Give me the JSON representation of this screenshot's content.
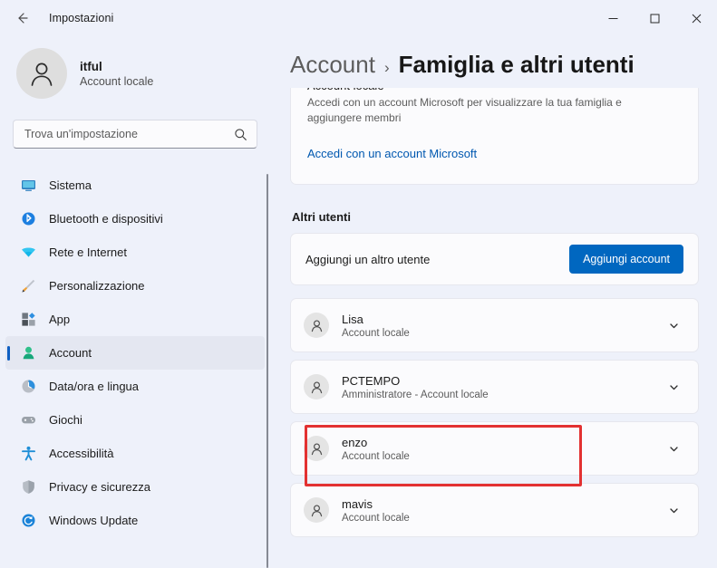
{
  "window": {
    "title": "Impostazioni",
    "back_icon": "back-arrow-icon",
    "minimize_label": "—",
    "maximize_label": "☐",
    "close_label": "✕"
  },
  "sidebar": {
    "profile": {
      "name": "itful",
      "subtitle": "Account locale",
      "avatar_icon": "person-icon"
    },
    "search": {
      "placeholder": "Trova un'impostazione",
      "value": "",
      "icon": "search-icon"
    },
    "items": [
      {
        "label": "Sistema",
        "icon": "monitor-icon",
        "selected": false
      },
      {
        "label": "Bluetooth e dispositivi",
        "icon": "bluetooth-icon",
        "selected": false
      },
      {
        "label": "Rete e Internet",
        "icon": "wifi-icon",
        "selected": false
      },
      {
        "label": "Personalizzazione",
        "icon": "paintbrush-icon",
        "selected": false
      },
      {
        "label": "App",
        "icon": "apps-icon",
        "selected": false
      },
      {
        "label": "Account",
        "icon": "account-person-icon",
        "selected": true
      },
      {
        "label": "Data/ora e lingua",
        "icon": "clock-icon",
        "selected": false
      },
      {
        "label": "Giochi",
        "icon": "gamepad-icon",
        "selected": false
      },
      {
        "label": "Accessibilità",
        "icon": "accessibility-icon",
        "selected": false
      },
      {
        "label": "Privacy e sicurezza",
        "icon": "shield-icon",
        "selected": false
      },
      {
        "label": "Windows Update",
        "icon": "update-icon",
        "selected": false
      }
    ]
  },
  "main": {
    "breadcrumb": {
      "parent": "Account",
      "separator": "›",
      "current": "Famiglia e altri utenti"
    },
    "microsoft_card": {
      "title": "Account locale",
      "description": "Accedi con un account Microsoft per visualizzare la tua famiglia e aggiungere membri",
      "link": "Accedi con un account Microsoft"
    },
    "other_users": {
      "section_title": "Altri utenti",
      "add_row": {
        "label": "Aggiungi un altro utente",
        "button": "Aggiungi account"
      },
      "users": [
        {
          "name": "Lisa",
          "subtitle": "Account locale",
          "avatar_icon": "person-icon",
          "expander_icon": "chevron-down-icon",
          "highlighted": false
        },
        {
          "name": "PCTEMPO",
          "subtitle": "Amministratore - Account locale",
          "avatar_icon": "person-icon",
          "expander_icon": "chevron-down-icon",
          "highlighted": true
        },
        {
          "name": "enzo",
          "subtitle": "Account locale",
          "avatar_icon": "person-icon",
          "expander_icon": "chevron-down-icon",
          "highlighted": false
        },
        {
          "name": "mavis",
          "subtitle": "Account locale",
          "avatar_icon": "person-icon",
          "expander_icon": "chevron-down-icon",
          "highlighted": false
        }
      ]
    }
  },
  "colors": {
    "page_background": "#eef1fa",
    "card_background": "#fbfbfd",
    "accent": "#0067c0",
    "selected_indicator": "#0f5fc2",
    "highlight_annotation": "#e33131",
    "link": "#0058b0"
  }
}
